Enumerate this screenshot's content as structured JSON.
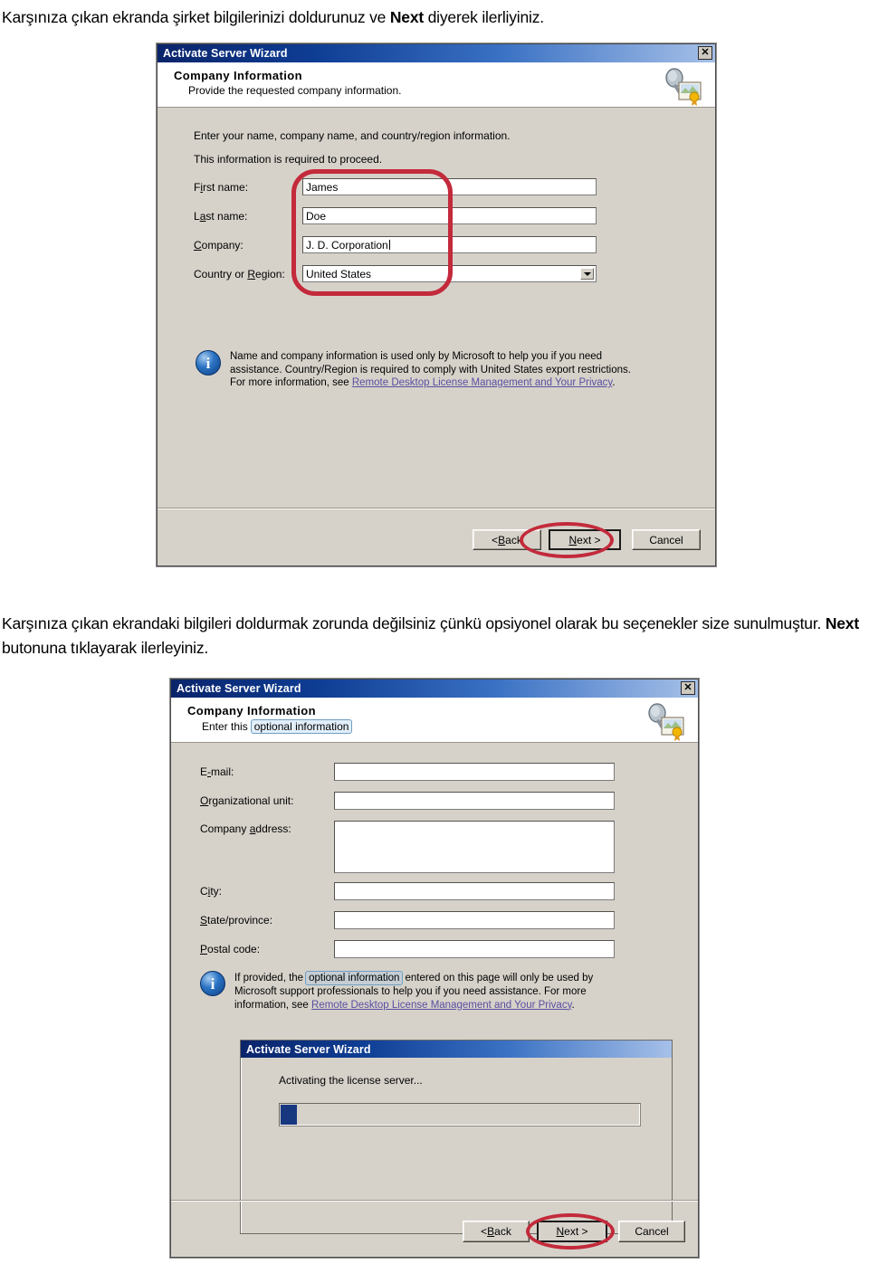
{
  "document": {
    "paragraph_1_before": "Karşınıza çıkan ekranda şirket bilgilerinizi doldurunuz ve ",
    "paragraph_1_bold": "Next",
    "paragraph_1_after": " diyerek ilerliyiniz.",
    "paragraph_2_before": "Karşınıza çıkan ekrandaki bilgileri doldurmak zorunda değilsiniz çünkü opsiyonel olarak bu seçenekler size sunulmuştur. ",
    "paragraph_2_bold": "Next",
    "paragraph_2_after": " butonuna tıklayarak ilerleyiniz."
  },
  "dialog1": {
    "title": "Activate Server Wizard",
    "close_label": "✕",
    "header_title": "Company Information",
    "header_subtitle": "Provide the requested company information.",
    "icon_name": "license-certificate-magnifier-icon",
    "intro_line1": "Enter your name, company name, and country/region information.",
    "intro_line2": "This information is required to proceed.",
    "fields": [
      {
        "label_pre": "F",
        "label_accel": "i",
        "label_post": "rst name:",
        "value": "James",
        "type": "text",
        "caret": false
      },
      {
        "label_pre": "L",
        "label_accel": "a",
        "label_post": "st name:",
        "value": "Doe",
        "type": "text",
        "caret": false
      },
      {
        "label_pre": "",
        "label_accel": "C",
        "label_post": "ompany:",
        "value": "J. D. Corporation",
        "type": "text",
        "caret": true
      },
      {
        "label_pre": "Country or ",
        "label_accel": "R",
        "label_post": "egion:",
        "value": "United States",
        "type": "combo",
        "caret": false
      }
    ],
    "info_line1": "Name and company information is used only by Microsoft to help you if you need",
    "info_line2": "assistance. Country/Region is required to comply with United States export restrictions.",
    "info_line3_pre": "For more information, see ",
    "info_link": "Remote Desktop License Management and Your Privacy",
    "info_line3_post": ".",
    "buttons": {
      "back_pre": "< ",
      "back_accel": "B",
      "back_post": "ack",
      "next_pre": "",
      "next_accel": "N",
      "next_post": "ext >",
      "cancel": "Cancel"
    },
    "annotation_fields_highlight": "red-rounded-rectangle-around-input-fields",
    "annotation_next_highlight": "red-ellipse-around-next-button"
  },
  "dialog2": {
    "title": "Activate Server Wizard",
    "close_label": "✕",
    "header_title": "Company Information",
    "header_subtitle_pre": "Enter this ",
    "header_subtitle_highlight": "optional information",
    "icon_name": "license-certificate-magnifier-icon",
    "fields": [
      {
        "label_pre": "E",
        "label_accel": "-",
        "label_post": "mail:",
        "type": "text",
        "value": ""
      },
      {
        "label_pre": "",
        "label_accel": "O",
        "label_post": "rganizational unit:",
        "type": "text",
        "value": ""
      },
      {
        "label_pre": "Company ",
        "label_accel": "a",
        "label_post": "ddress:",
        "type": "textarea",
        "value": ""
      },
      {
        "label_pre": "C",
        "label_accel": "i",
        "label_post": "ty:",
        "type": "text",
        "value": ""
      },
      {
        "label_pre": "",
        "label_accel": "S",
        "label_post": "tate/province:",
        "type": "text",
        "value": ""
      },
      {
        "label_pre": "",
        "label_accel": "P",
        "label_post": "ostal code:",
        "type": "text",
        "value": ""
      }
    ],
    "info_line1_pre": "If provided, the ",
    "info_line1_highlight": "optional information",
    "info_line1_post": " entered on this page will only be used by",
    "info_line2": "Microsoft support professionals to help you if you need assistance. For more",
    "info_line3_pre": "information, see ",
    "info_link": "Remote Desktop License Management and Your Privacy",
    "info_line3_post": ".",
    "buttons": {
      "back_pre": "< ",
      "back_accel": "B",
      "back_post": "ack",
      "next_pre": "",
      "next_accel": "N",
      "next_post": "ext >",
      "cancel": "Cancel"
    },
    "annotation_next_highlight": "red-ellipse-around-next-button"
  },
  "progress_dialog": {
    "title": "Activate Server Wizard",
    "status_text": "Activating the license server...",
    "progress_percent": 4
  },
  "colors": {
    "titlebar_start": "#0a246a",
    "titlebar_end": "#a6c0e8",
    "dialog_face": "#d6d2ca",
    "annotation_red": "#c32a3b",
    "link": "#5a4fa0",
    "progress_fill": "#17377f",
    "highlight_border": "#6f9fc4"
  }
}
